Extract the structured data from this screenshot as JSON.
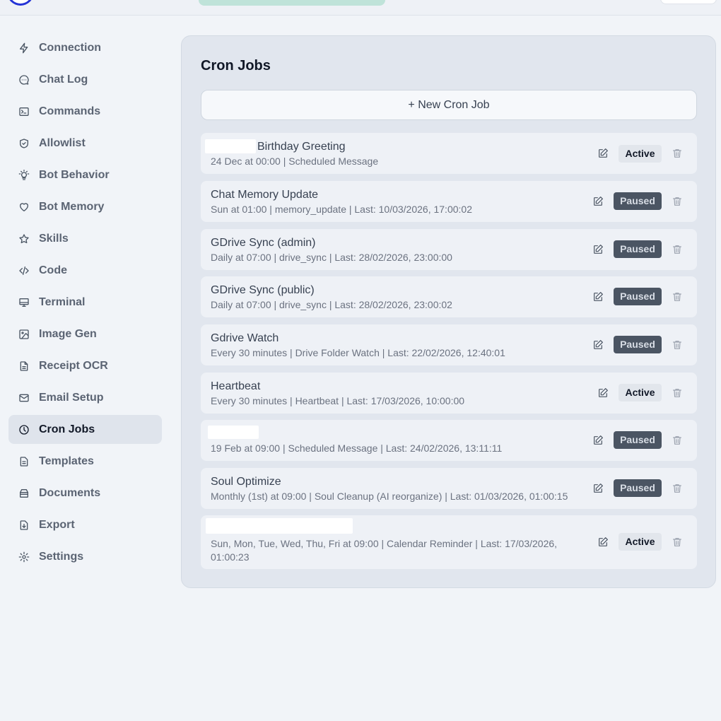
{
  "sidebar": {
    "items": [
      {
        "label": "Connection",
        "icon": "bolt-icon",
        "active": false
      },
      {
        "label": "Chat Log",
        "icon": "chat-bubble-icon",
        "active": false
      },
      {
        "label": "Commands",
        "icon": "terminal-box-icon",
        "active": false
      },
      {
        "label": "Allowlist",
        "icon": "shield-check-icon",
        "active": false
      },
      {
        "label": "Bot Behavior",
        "icon": "lightbulb-icon",
        "active": false
      },
      {
        "label": "Bot Memory",
        "icon": "heart-icon",
        "active": false
      },
      {
        "label": "Skills",
        "icon": "star-icon",
        "active": false
      },
      {
        "label": "Code",
        "icon": "code-icon",
        "active": false
      },
      {
        "label": "Terminal",
        "icon": "monitor-icon",
        "active": false
      },
      {
        "label": "Image Gen",
        "icon": "image-icon",
        "active": false
      },
      {
        "label": "Receipt OCR",
        "icon": "document-icon",
        "active": false
      },
      {
        "label": "Email Setup",
        "icon": "mail-icon",
        "active": false
      },
      {
        "label": "Cron Jobs",
        "icon": "clock-icon",
        "active": true
      },
      {
        "label": "Templates",
        "icon": "template-icon",
        "active": false
      },
      {
        "label": "Documents",
        "icon": "archive-icon",
        "active": false
      },
      {
        "label": "Export",
        "icon": "download-file-icon",
        "active": false
      },
      {
        "label": "Settings",
        "icon": "gear-icon",
        "active": false
      }
    ]
  },
  "main": {
    "title": "Cron Jobs",
    "new_button": "+ New Cron Job",
    "jobs": [
      {
        "name": "Birthday Greeting",
        "meta": "24 Dec at 00:00 | Scheduled Message",
        "status": "Active"
      },
      {
        "name": "Chat Memory Update",
        "meta": "Sun at 01:00 | memory_update | Last: 10/03/2026, 17:00:02",
        "status": "Paused"
      },
      {
        "name": "GDrive Sync (admin)",
        "meta": "Daily at 07:00 | drive_sync | Last: 28/02/2026, 23:00:00",
        "status": "Paused"
      },
      {
        "name": "GDrive Sync (public)",
        "meta": "Daily at 07:00 | drive_sync | Last: 28/02/2026, 23:00:02",
        "status": "Paused"
      },
      {
        "name": "Gdrive Watch",
        "meta": "Every 30 minutes | Drive Folder Watch | Last: 22/02/2026, 12:40:01",
        "status": "Paused"
      },
      {
        "name": "Heartbeat",
        "meta": "Every 30 minutes | Heartbeat | Last: 17/03/2026, 10:00:00",
        "status": "Active"
      },
      {
        "name": "",
        "meta": "19 Feb at 09:00 | Scheduled Message | Last: 24/02/2026, 13:11:11",
        "status": "Paused"
      },
      {
        "name": "Soul Optimize",
        "meta": "Monthly (1st) at 09:00 | Soul Cleanup (AI reorganize) | Last: 01/03/2026, 01:00:15",
        "status": "Paused"
      },
      {
        "name": "",
        "meta": "Sun, Mon, Tue, Wed, Thu, Fri at 09:00 | Calendar Reminder | Last: 17/03/2026, 01:00:23",
        "status": "Active"
      }
    ]
  }
}
